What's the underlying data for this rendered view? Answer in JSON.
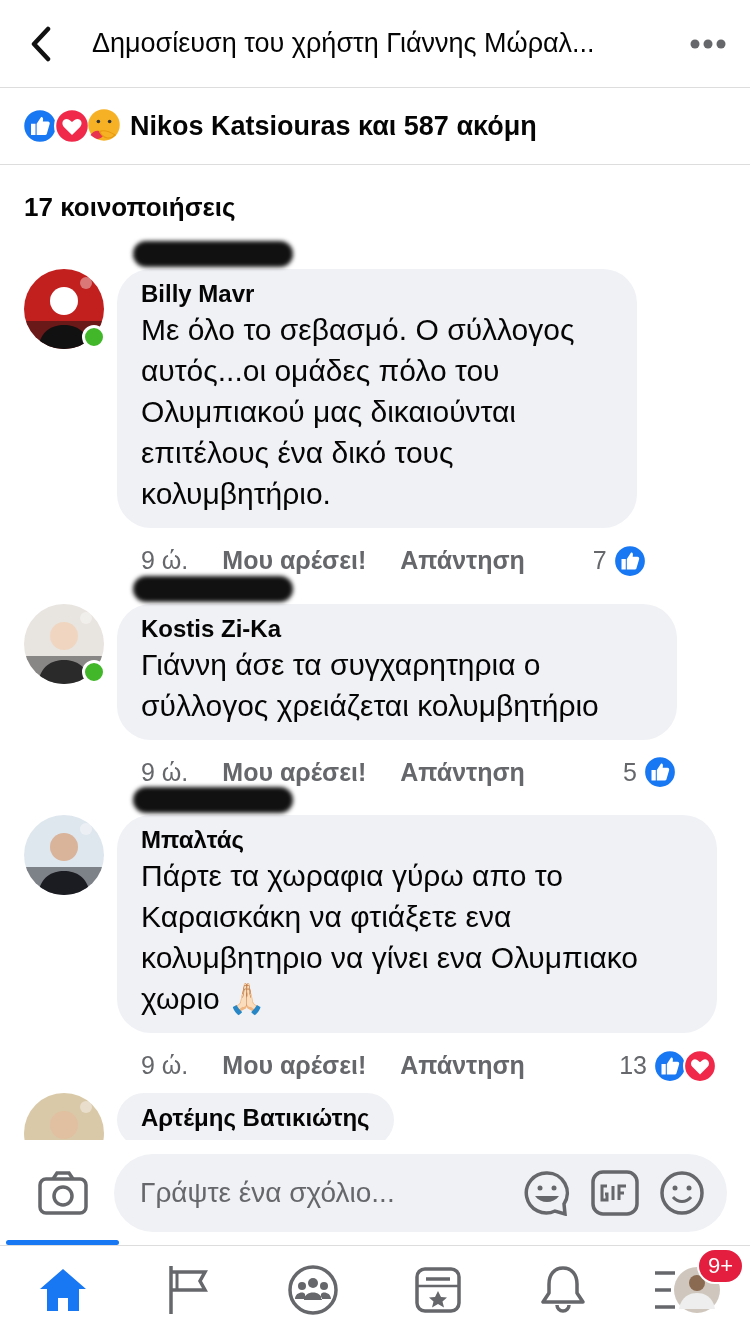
{
  "header": {
    "title": "Δημοσίευση του χρήστη Γιάννης Μώραλ..."
  },
  "reactions_summary": {
    "reactions": [
      {
        "kind": "like"
      },
      {
        "kind": "love"
      },
      {
        "kind": "care"
      }
    ],
    "text": "Nikos Katsiouras και 587 ακόμη"
  },
  "shares": "17 κοινοποιήσεις",
  "comments": [
    {
      "author": "Billy Mavr",
      "online": true,
      "redacted": true,
      "text": "Με όλο το σεβασμό. Ο σύλλογος αυτός...οι ομάδες πόλο του Ολυμπιακού μας δικαιούνται επιτέλους ένα δικό τους κολυμβητήριο.",
      "time": "9 ώ.",
      "like": "Μου αρέσει!",
      "reply": "Απάντηση",
      "count": "7",
      "reactions": [
        {
          "kind": "like"
        }
      ]
    },
    {
      "author": "Kostis Zi-Ka",
      "online": true,
      "redacted": true,
      "text": "Γιάννη άσε τα συγχαρητηρια ο σύλλογος χρειάζεται κολυμβητήριο",
      "time": "9 ώ.",
      "like": "Μου αρέσει!",
      "reply": "Απάντηση",
      "count": "5",
      "reactions": [
        {
          "kind": "like"
        }
      ]
    },
    {
      "author": "Μπαλτάς",
      "online": false,
      "redacted": true,
      "text": "Πάρτε τα χωραφια γύρω απο το Καραισκάκη να φτιάξετε ενα κολυμβητηριο να γίνει ενα Ολυμπιακο χωριο 🙏🏻",
      "time": "9 ώ.",
      "like": "Μου αρέσει!",
      "reply": "Απάντηση",
      "count": "13",
      "reactions": [
        {
          "kind": "like"
        },
        {
          "kind": "love"
        }
      ]
    },
    {
      "author": "Αρτέμης Βατικιώτης",
      "online": false,
      "redacted": false
    }
  ],
  "composer": {
    "placeholder": "Γράψτε ένα σχόλιο..."
  },
  "tabbar": [
    {
      "kind": "home",
      "selected": true
    },
    {
      "kind": "pages",
      "selected": false
    },
    {
      "kind": "groups",
      "selected": false
    },
    {
      "kind": "events",
      "selected": false
    },
    {
      "kind": "notifications",
      "selected": false
    },
    {
      "kind": "menu",
      "selected": false,
      "badge": "9+"
    }
  ]
}
